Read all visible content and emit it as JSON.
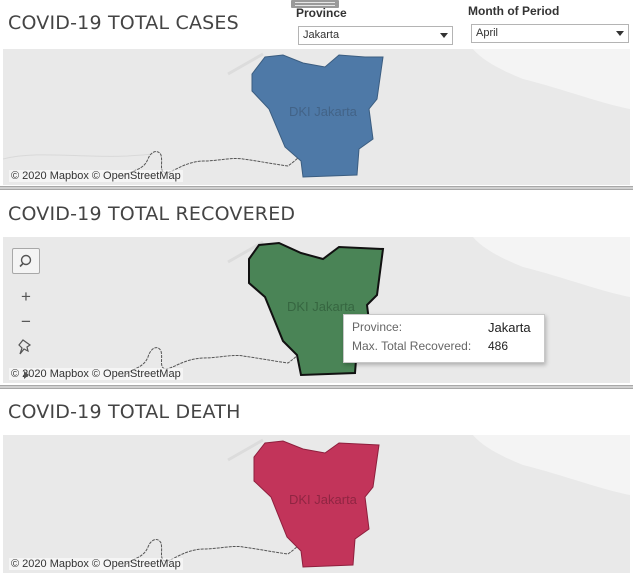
{
  "filters": {
    "province_label": "Province",
    "province_value": "Jakarta",
    "month_label": "Month of Period",
    "month_value": "April"
  },
  "sections": [
    {
      "title": "COVID-19 TOTAL CASES",
      "region_label": "DKI Jakarta",
      "fill_color": "#4e79a7",
      "attribution": "© 2020 Mapbox © OpenStreetMap"
    },
    {
      "title": "COVID-19 TOTAL RECOVERED",
      "region_label": "DKI Jakarta",
      "fill_color": "#4a8456",
      "attribution": "© 2020 Mapbox © OpenStreetMap"
    },
    {
      "title": "COVID-19 TOTAL DEATH",
      "region_label": "DKI Jakarta",
      "fill_color": "#c2345a",
      "attribution": "© 2020 Mapbox © OpenStreetMap"
    }
  ],
  "map_tools": {
    "search_icon": "magnifier-icon",
    "zoom_in": "+",
    "zoom_out": "−",
    "pin_icon": "pin-icon"
  },
  "tooltip": {
    "rows": [
      {
        "key": "Province:",
        "value": "Jakarta"
      },
      {
        "key": "Max. Total Recovered:",
        "value": "486"
      }
    ]
  }
}
